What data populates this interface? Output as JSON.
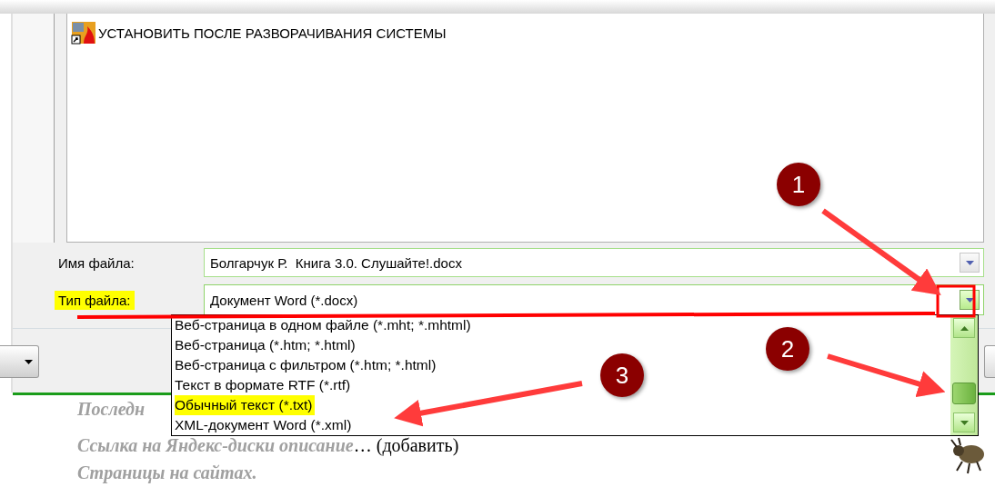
{
  "file_list": {
    "items": [
      {
        "name": "УСТАНОВИТЬ ПОСЛЕ РАЗВОРАЧИВАНИЯ СИСТЕМЫ"
      }
    ]
  },
  "file_name": {
    "label": "Имя файла:",
    "highlighted": false,
    "value": "Болгарчук Р.  Книга 3.0. Слушайте!.docx"
  },
  "file_type": {
    "label": "Тип файла:",
    "highlighted": true,
    "value": "Документ Word (*.docx)",
    "expanded": true,
    "options": [
      {
        "label": "Веб-страница в одном файле (*.mht; *.mhtml)",
        "selected": false
      },
      {
        "label": "Веб-страница (*.htm; *.html)",
        "selected": false
      },
      {
        "label": "Веб-страница с фильтром (*.htm; *.html)",
        "selected": false
      },
      {
        "label": "Текст в формате RTF (*.rtf)",
        "selected": false
      },
      {
        "label": "Обычный текст (*.txt)",
        "selected": true
      },
      {
        "label": "XML-документ Word (*.xml)",
        "selected": false
      }
    ]
  },
  "callouts": [
    {
      "number": "1"
    },
    {
      "number": "2"
    },
    {
      "number": "3"
    }
  ],
  "page_text": [
    {
      "text": "Последн"
    },
    {
      "text": "Ссылка на Яндекс-диски описание",
      "suffix": "… (добавить)"
    },
    {
      "text": "Страницы на сайтах."
    }
  ]
}
